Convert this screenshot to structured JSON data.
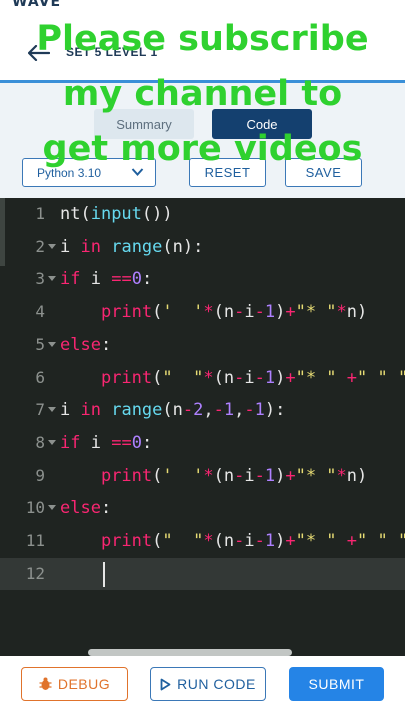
{
  "header": {
    "brand": "WAVE™",
    "breadcrumb": "SET 5 LEVEL 1"
  },
  "tabs": {
    "summary": "Summary",
    "code": "Code"
  },
  "toolbar": {
    "language": "Python 3.10",
    "reset_label": "RESET",
    "save_label": "SAVE"
  },
  "editor": {
    "line_numbers": [
      "1",
      "2",
      "3",
      "4",
      "5",
      "6",
      "7",
      "8",
      "9",
      "10",
      "11",
      "12"
    ],
    "lines": [
      [
        {
          "t": "plain",
          "v": "nt("
        },
        {
          "t": "fn",
          "v": "input"
        },
        {
          "t": "plain",
          "v": "())"
        }
      ],
      [
        {
          "t": "plain",
          "v": "i "
        },
        {
          "t": "kw",
          "v": "in"
        },
        {
          "t": "plain",
          "v": " "
        },
        {
          "t": "fn",
          "v": "range"
        },
        {
          "t": "plain",
          "v": "(n):"
        }
      ],
      [
        {
          "t": "kw",
          "v": "if"
        },
        {
          "t": "plain",
          "v": " i "
        },
        {
          "t": "kw",
          "v": "=="
        },
        {
          "t": "num",
          "v": "0"
        },
        {
          "t": "plain",
          "v": ":"
        }
      ],
      [
        {
          "t": "plain",
          "v": "    "
        },
        {
          "t": "kw",
          "v": "print"
        },
        {
          "t": "plain",
          "v": "("
        },
        {
          "t": "str",
          "v": "'  '"
        },
        {
          "t": "kw",
          "v": "*"
        },
        {
          "t": "plain",
          "v": "(n"
        },
        {
          "t": "kw",
          "v": "-"
        },
        {
          "t": "plain",
          "v": "i"
        },
        {
          "t": "kw",
          "v": "-"
        },
        {
          "t": "num",
          "v": "1"
        },
        {
          "t": "plain",
          "v": ")"
        },
        {
          "t": "kw",
          "v": "+"
        },
        {
          "t": "str",
          "v": "\"* \""
        },
        {
          "t": "kw",
          "v": "*"
        },
        {
          "t": "plain",
          "v": "n)"
        }
      ],
      [
        {
          "t": "kw",
          "v": "else"
        },
        {
          "t": "plain",
          "v": ":"
        }
      ],
      [
        {
          "t": "plain",
          "v": "    "
        },
        {
          "t": "kw",
          "v": "print"
        },
        {
          "t": "plain",
          "v": "("
        },
        {
          "t": "str",
          "v": "\"  \""
        },
        {
          "t": "kw",
          "v": "*"
        },
        {
          "t": "plain",
          "v": "(n"
        },
        {
          "t": "kw",
          "v": "-"
        },
        {
          "t": "plain",
          "v": "i"
        },
        {
          "t": "kw",
          "v": "-"
        },
        {
          "t": "num",
          "v": "1"
        },
        {
          "t": "plain",
          "v": ")"
        },
        {
          "t": "kw",
          "v": "+"
        },
        {
          "t": "str",
          "v": "\"* \""
        },
        {
          "t": "plain",
          "v": " "
        },
        {
          "t": "kw",
          "v": "+"
        },
        {
          "t": "str",
          "v": "\" \""
        },
        {
          "t": "plain",
          "v": " "
        },
        {
          "t": "str",
          "v": "\"*"
        }
      ],
      [
        {
          "t": "plain",
          "v": "i "
        },
        {
          "t": "kw",
          "v": "in"
        },
        {
          "t": "plain",
          "v": " "
        },
        {
          "t": "fn",
          "v": "range"
        },
        {
          "t": "plain",
          "v": "(n"
        },
        {
          "t": "kw",
          "v": "-"
        },
        {
          "t": "num",
          "v": "2"
        },
        {
          "t": "plain",
          "v": ","
        },
        {
          "t": "kw",
          "v": "-"
        },
        {
          "t": "num",
          "v": "1"
        },
        {
          "t": "plain",
          "v": ","
        },
        {
          "t": "kw",
          "v": "-"
        },
        {
          "t": "num",
          "v": "1"
        },
        {
          "t": "plain",
          "v": "):"
        }
      ],
      [
        {
          "t": "kw",
          "v": "if"
        },
        {
          "t": "plain",
          "v": " i "
        },
        {
          "t": "kw",
          "v": "=="
        },
        {
          "t": "num",
          "v": "0"
        },
        {
          "t": "plain",
          "v": ":"
        }
      ],
      [
        {
          "t": "plain",
          "v": "    "
        },
        {
          "t": "kw",
          "v": "print"
        },
        {
          "t": "plain",
          "v": "("
        },
        {
          "t": "str",
          "v": "'  '"
        },
        {
          "t": "kw",
          "v": "*"
        },
        {
          "t": "plain",
          "v": "(n"
        },
        {
          "t": "kw",
          "v": "-"
        },
        {
          "t": "plain",
          "v": "i"
        },
        {
          "t": "kw",
          "v": "-"
        },
        {
          "t": "num",
          "v": "1"
        },
        {
          "t": "plain",
          "v": ")"
        },
        {
          "t": "kw",
          "v": "+"
        },
        {
          "t": "str",
          "v": "\"* \""
        },
        {
          "t": "kw",
          "v": "*"
        },
        {
          "t": "plain",
          "v": "n)"
        }
      ],
      [
        {
          "t": "kw",
          "v": "else"
        },
        {
          "t": "plain",
          "v": ":"
        }
      ],
      [
        {
          "t": "plain",
          "v": "    "
        },
        {
          "t": "kw",
          "v": "print"
        },
        {
          "t": "plain",
          "v": "("
        },
        {
          "t": "str",
          "v": "\"  \""
        },
        {
          "t": "kw",
          "v": "*"
        },
        {
          "t": "plain",
          "v": "(n"
        },
        {
          "t": "kw",
          "v": "-"
        },
        {
          "t": "plain",
          "v": "i"
        },
        {
          "t": "kw",
          "v": "-"
        },
        {
          "t": "num",
          "v": "1"
        },
        {
          "t": "plain",
          "v": ")"
        },
        {
          "t": "kw",
          "v": "+"
        },
        {
          "t": "str",
          "v": "\"* \""
        },
        {
          "t": "plain",
          "v": " "
        },
        {
          "t": "kw",
          "v": "+"
        },
        {
          "t": "str",
          "v": "\" \""
        },
        {
          "t": "plain",
          "v": " "
        },
        {
          "t": "str",
          "v": "\"*"
        }
      ],
      []
    ]
  },
  "footer": {
    "debug_label": "DEBUG",
    "run_label": "RUN CODE",
    "submit_label": "SUBMIT"
  },
  "overlay": {
    "lines": [
      "Please subscribe",
      "my channel to",
      "get more videos"
    ]
  },
  "colors": {
    "primary": "#14406f",
    "accent": "#2584e6",
    "debug": "#e0732c",
    "overlay_text": "#2fd12f",
    "editor_bg": "#1f2421"
  },
  "icons": {
    "back": "arrow-left-icon",
    "language": "chevron-down-icon",
    "debug": "bug-icon",
    "run": "play-icon"
  }
}
